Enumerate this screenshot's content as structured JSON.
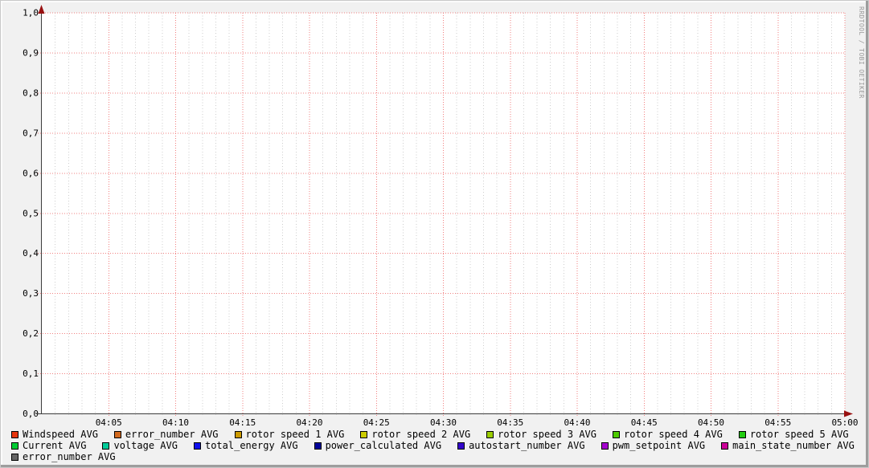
{
  "watermark": "RRDTOOL / TOBI OETIKER",
  "chart_data": {
    "type": "line",
    "title": "",
    "xlabel": "",
    "ylabel": "",
    "ylim": [
      0.0,
      1.0
    ],
    "grid": true,
    "legend_position": "bottom",
    "decimal_separator": ",",
    "x_axis": {
      "tick_labels": [
        "04:05",
        "04:10",
        "04:15",
        "04:20",
        "04:25",
        "04:30",
        "04:35",
        "04:40",
        "04:45",
        "04:50",
        "04:55",
        "05:00"
      ],
      "minutes_per_major": 5,
      "minutes_per_minor": 1,
      "range_minutes": 60
    },
    "y_axis": {
      "tick_labels": [
        "1,0",
        "0,9",
        "0,8",
        "0,7",
        "0,6",
        "0,5",
        "0,4",
        "0,3",
        "0,2",
        "0,1",
        "0,0"
      ],
      "tick_values": [
        1.0,
        0.9,
        0.8,
        0.7,
        0.6,
        0.5,
        0.4,
        0.3,
        0.2,
        0.1,
        0.0
      ]
    },
    "series": [
      {
        "label": "Windspeed AVG",
        "color": "#e6350e",
        "values": []
      },
      {
        "label": "error_number AVG",
        "color": "#d2691e",
        "values": []
      },
      {
        "label": "rotor speed 1 AVG",
        "color": "#cc9a00",
        "values": []
      },
      {
        "label": "rotor speed 2 AVG",
        "color": "#cdcd00",
        "values": []
      },
      {
        "label": "rotor speed 3 AVG",
        "color": "#9acd00",
        "values": []
      },
      {
        "label": "rotor speed 4 AVG",
        "color": "#4ecb00",
        "values": []
      },
      {
        "label": "rotor speed 5 AVG",
        "color": "#22cc11",
        "values": []
      },
      {
        "label": "Current AVG",
        "color": "#00cc33",
        "values": []
      },
      {
        "label": "voltage AVG",
        "color": "#00cc99",
        "values": []
      },
      {
        "label": "total_energy AVG",
        "color": "#0f0fee",
        "values": []
      },
      {
        "label": "power_calculated AVG",
        "color": "#000099",
        "values": []
      },
      {
        "label": "autostart_number AVG",
        "color": "#3305cc",
        "values": []
      },
      {
        "label": "pwm_setpoint AVG",
        "color": "#a503cf",
        "values": []
      },
      {
        "label": "main_state_number AVG",
        "color": "#cc0199",
        "values": []
      },
      {
        "label": "error_number AVG",
        "color": "#666666",
        "values": []
      }
    ],
    "note": "empty graph - no data plotted for any series"
  },
  "legend_layout": {
    "rows": [
      [
        0,
        1,
        2,
        3,
        4,
        5,
        6
      ],
      [
        7,
        8,
        9,
        10,
        11,
        12,
        13
      ],
      [
        14
      ]
    ]
  },
  "colors": {
    "face": "#f1f1f1",
    "canvas": "#ffffff",
    "grid_minor": "#cccccc",
    "grid_major": "#f28080",
    "axis": "#3d3d3d",
    "arrow": "#991111",
    "text": "#000000",
    "watermark": "#999999"
  }
}
